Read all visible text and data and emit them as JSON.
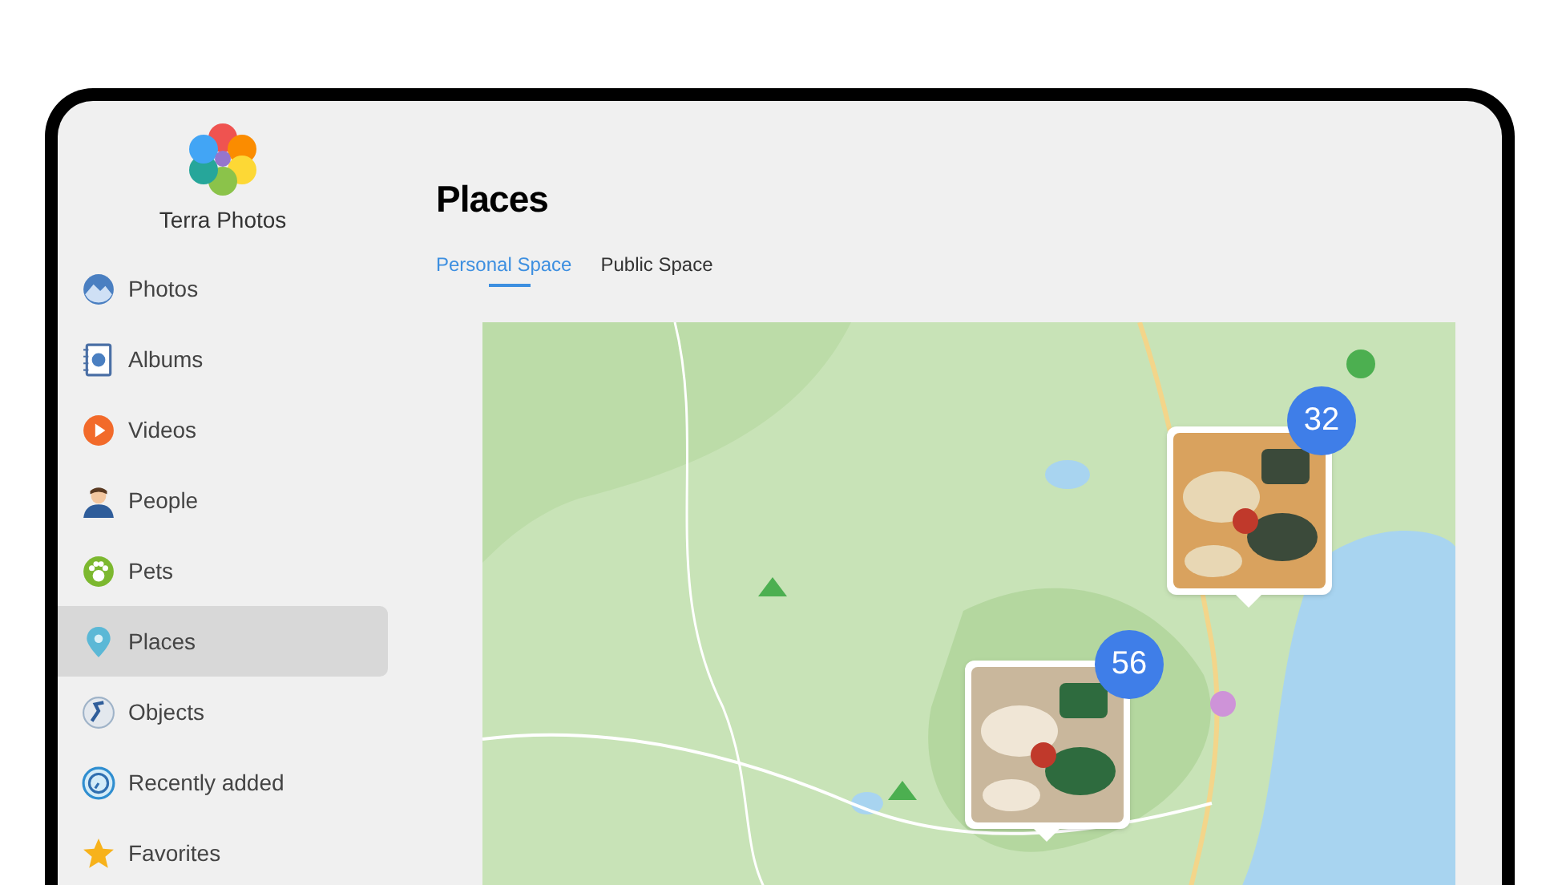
{
  "app": {
    "name": "Terra Photos"
  },
  "sidebar": {
    "items": [
      {
        "label": "Photos",
        "selected": false
      },
      {
        "label": "Albums",
        "selected": false
      },
      {
        "label": "Videos",
        "selected": false
      },
      {
        "label": "People",
        "selected": false
      },
      {
        "label": "Pets",
        "selected": false
      },
      {
        "label": "Places",
        "selected": true
      },
      {
        "label": "Objects",
        "selected": false
      },
      {
        "label": "Recently added",
        "selected": false
      },
      {
        "label": "Favorites",
        "selected": false
      }
    ]
  },
  "page": {
    "title": "Places"
  },
  "tabs": [
    {
      "label": "Personal Space",
      "selected": true
    },
    {
      "label": "Public Space",
      "selected": false
    }
  ],
  "map": {
    "clusters": [
      {
        "count": "32"
      },
      {
        "count": "56"
      }
    ]
  }
}
